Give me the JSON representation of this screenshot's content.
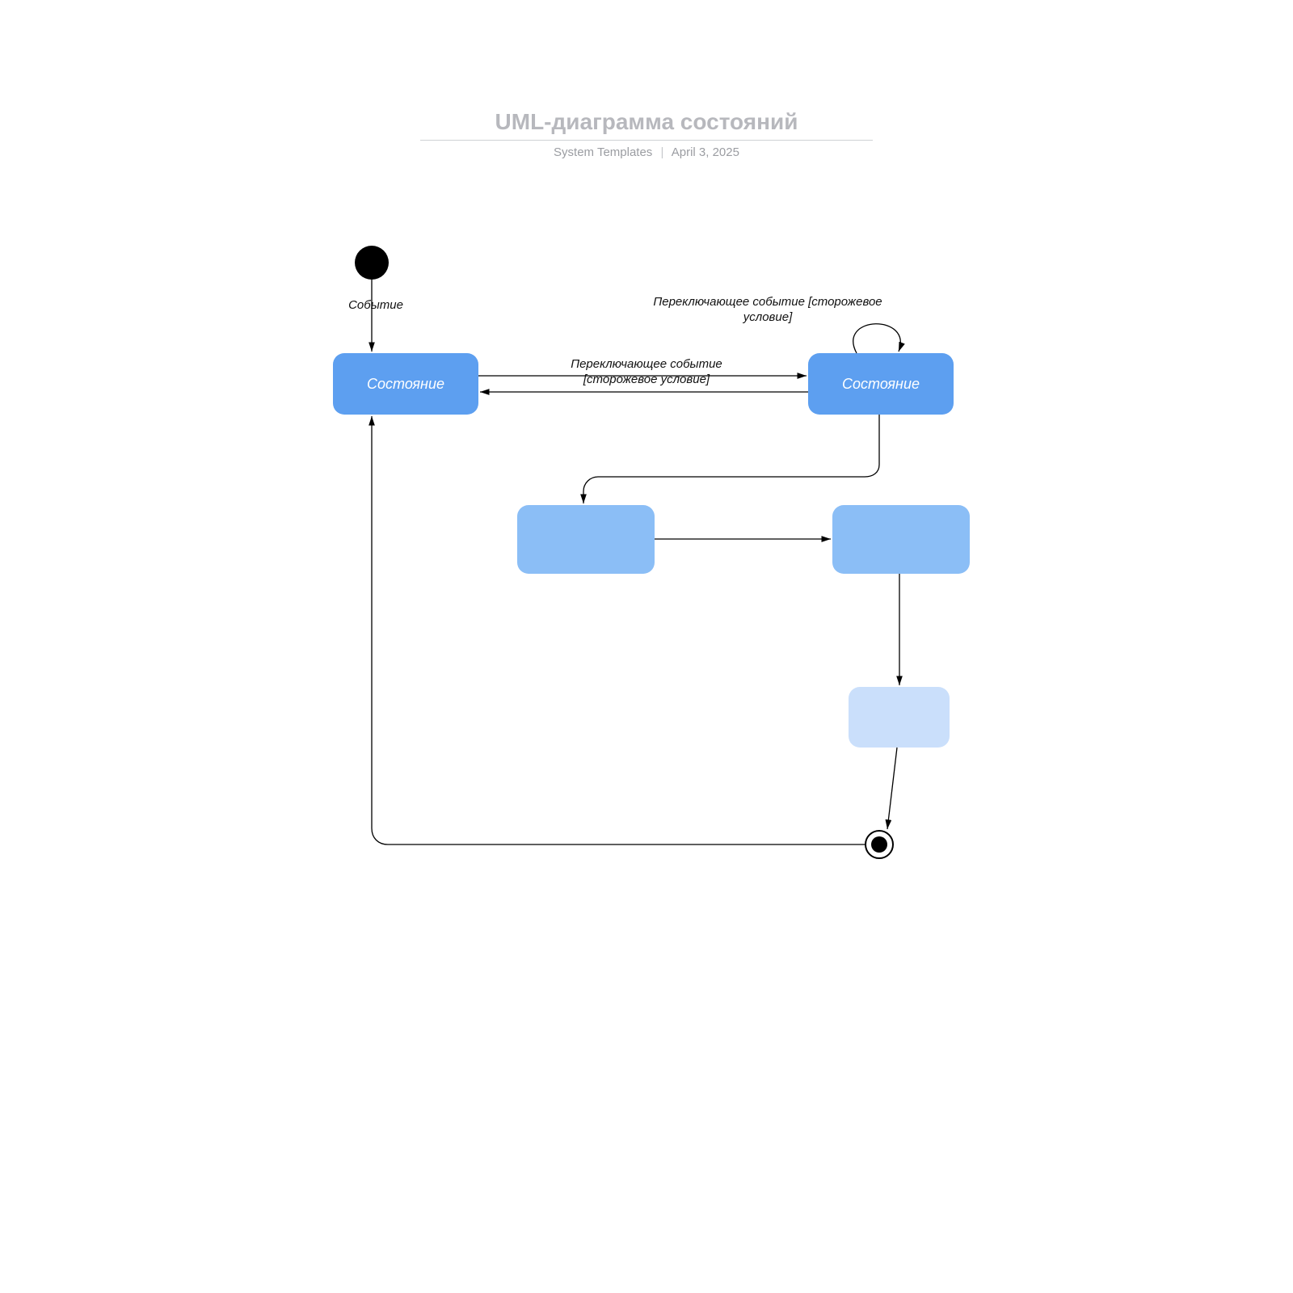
{
  "header": {
    "title": "UML-диаграмма состояний",
    "author": "System Templates",
    "date": "April 3, 2025"
  },
  "labels": {
    "event": "Событие",
    "transition_guard_1": "Переключающее событие [сторожевое условие]",
    "transition_guard_2": "Переключающее событие [сторожевое условие]"
  },
  "states": {
    "state1": "Состояние",
    "state2": "Состояние",
    "state3": "",
    "state4": "",
    "state5": ""
  }
}
